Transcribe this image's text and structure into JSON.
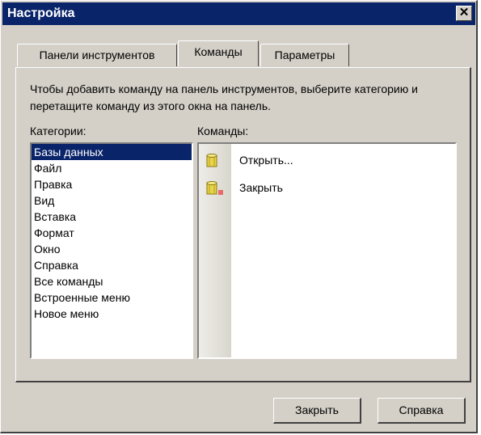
{
  "window": {
    "title": "Настройка",
    "close_symbol": "✕"
  },
  "tabs": [
    {
      "label": "Панели инструментов"
    },
    {
      "label": "Команды"
    },
    {
      "label": "Параметры"
    }
  ],
  "description": "Чтобы добавить команду на панель инструментов, выберите категорию и перетащите команду из этого окна на панель.",
  "categories": {
    "label": "Категории:",
    "selected": "Базы данных",
    "items": [
      "Базы данных",
      "Файл",
      "Правка",
      "Вид",
      "Вставка",
      "Формат",
      "Окно",
      "Справка",
      "Все команды",
      "Встроенные меню",
      "Новое меню"
    ]
  },
  "commands": {
    "label": "Команды:",
    "items": [
      {
        "label": "Открыть...",
        "icon": "database-icon"
      },
      {
        "label": "Закрыть",
        "icon": "database-close-icon"
      }
    ]
  },
  "buttons": {
    "close": "Закрыть",
    "help": "Справка"
  },
  "colors": {
    "titlebar": "#0a246a",
    "face": "#d4d0c8",
    "selection": "#0a246a",
    "db_icon": "#e8d34a",
    "close_mark": "#e86a6a"
  }
}
